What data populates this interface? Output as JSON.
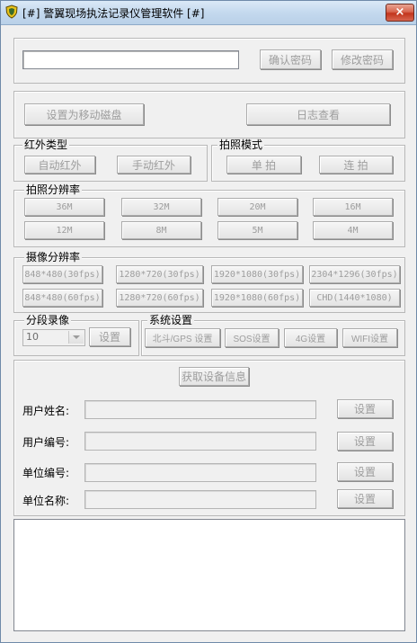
{
  "window": {
    "title": "[#] 警翼现场执法记录仪管理软件 [#]",
    "close": "×"
  },
  "password": {
    "value": "",
    "confirm": "确认密码",
    "modify": "修改密码"
  },
  "disk": {
    "set_mobile": "设置为移动磁盘",
    "log_view": "日志查看"
  },
  "infrared": {
    "legend": "红外类型",
    "auto": "自动红外",
    "manual": "手动红外"
  },
  "photo_mode": {
    "legend": "拍照模式",
    "single": "单 拍",
    "burst": "连 拍"
  },
  "photo_res": {
    "legend": "拍照分辨率",
    "options": [
      "36M",
      "32M",
      "20M",
      "16M",
      "12M",
      "8M",
      "5M",
      "4M"
    ]
  },
  "video_res": {
    "legend": "摄像分辨率",
    "options": [
      "848*480(30fps)",
      "1280*720(30fps)",
      "1920*1080(30fps)",
      "2304*1296(30fps)",
      "848*480(60fps)",
      "1280*720(60fps)",
      "1920*1080(60fps)",
      "CHD(1440*1080)"
    ]
  },
  "segment": {
    "legend": "分段录像",
    "value": "10",
    "set": "设置"
  },
  "system": {
    "legend": "系统设置",
    "gps": "北斗/GPS 设置",
    "sos": "SOS设置",
    "g4": "4G设置",
    "wifi": "WIFI设置"
  },
  "device": {
    "get_info": "获取设备信息",
    "fields": [
      {
        "label": "用户姓名:",
        "value": "",
        "button": "设置"
      },
      {
        "label": "用户编号:",
        "value": "",
        "button": "设置"
      },
      {
        "label": "单位编号:",
        "value": "",
        "button": "设置"
      },
      {
        "label": "单位名称:",
        "value": "",
        "button": "设置"
      }
    ]
  },
  "output": {
    "text": ""
  },
  "colors": {
    "titlebar": "#c4d9ee",
    "close": "#c2341c",
    "disabled_text": "#9d9d9d"
  },
  "icons": {
    "app": "shield-icon",
    "close": "close-icon",
    "dropdown": "chevron-down-icon"
  }
}
